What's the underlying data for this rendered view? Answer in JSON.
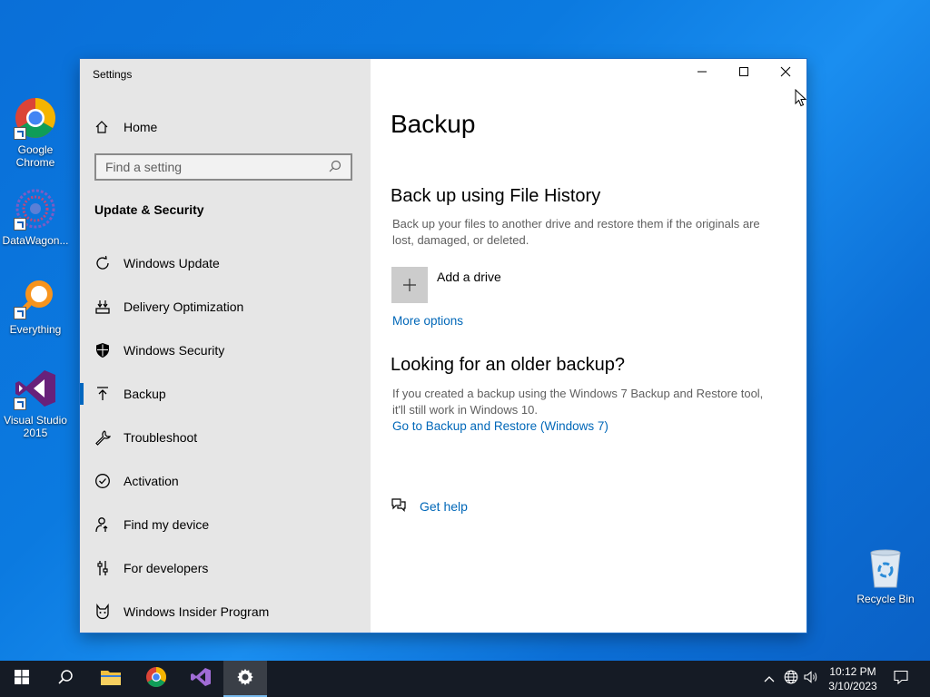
{
  "desktop": {
    "icons": [
      {
        "label": "Google Chrome",
        "icon": "chrome-icon"
      },
      {
        "label": "DataWagon...",
        "icon": "datawagon-icon"
      },
      {
        "label": "Everything",
        "icon": "everything-search-icon"
      },
      {
        "label": "Visual Studio 2015",
        "icon": "visual-studio-icon"
      }
    ],
    "recycle_bin": {
      "label": "Recycle Bin",
      "icon": "recycle-bin-icon"
    }
  },
  "window": {
    "title": "Settings",
    "controls": {
      "minimize": "minimize-icon",
      "maximize": "maximize-icon",
      "close": "close-icon"
    }
  },
  "sidebar": {
    "home_label": "Home",
    "search_placeholder": "Find a setting",
    "section_title": "Update & Security",
    "items": [
      {
        "label": "Windows Update",
        "icon": "refresh-icon"
      },
      {
        "label": "Delivery Optimization",
        "icon": "delivery-icon"
      },
      {
        "label": "Windows Security",
        "icon": "shield-icon"
      },
      {
        "label": "Backup",
        "icon": "backup-arrow-icon",
        "active": true
      },
      {
        "label": "Troubleshoot",
        "icon": "wrench-icon"
      },
      {
        "label": "Activation",
        "icon": "check-circle-icon"
      },
      {
        "label": "Find my device",
        "icon": "person-pin-icon"
      },
      {
        "label": "For developers",
        "icon": "developer-sliders-icon"
      },
      {
        "label": "Windows Insider Program",
        "icon": "insider-cat-icon"
      }
    ]
  },
  "main": {
    "page_title": "Backup",
    "file_history": {
      "heading": "Back up using File History",
      "description": "Back up your files to another drive and restore them if the originals are lost, damaged, or deleted.",
      "add_drive_label": "Add a drive",
      "more_options_link": "More options"
    },
    "older_backup": {
      "heading": "Looking for an older backup?",
      "description": "If you created a backup using the Windows 7 Backup and Restore tool, it'll still work in Windows 10.",
      "link": "Go to Backup and Restore (Windows 7)"
    },
    "help_link": "Get help"
  },
  "taskbar": {
    "time": "10:12 PM",
    "date": "3/10/2023"
  },
  "colors": {
    "accent": "#0067c0",
    "link": "#0067b8",
    "sidebar_bg": "#e6e6e6",
    "taskbar_bg": "#151b25"
  }
}
